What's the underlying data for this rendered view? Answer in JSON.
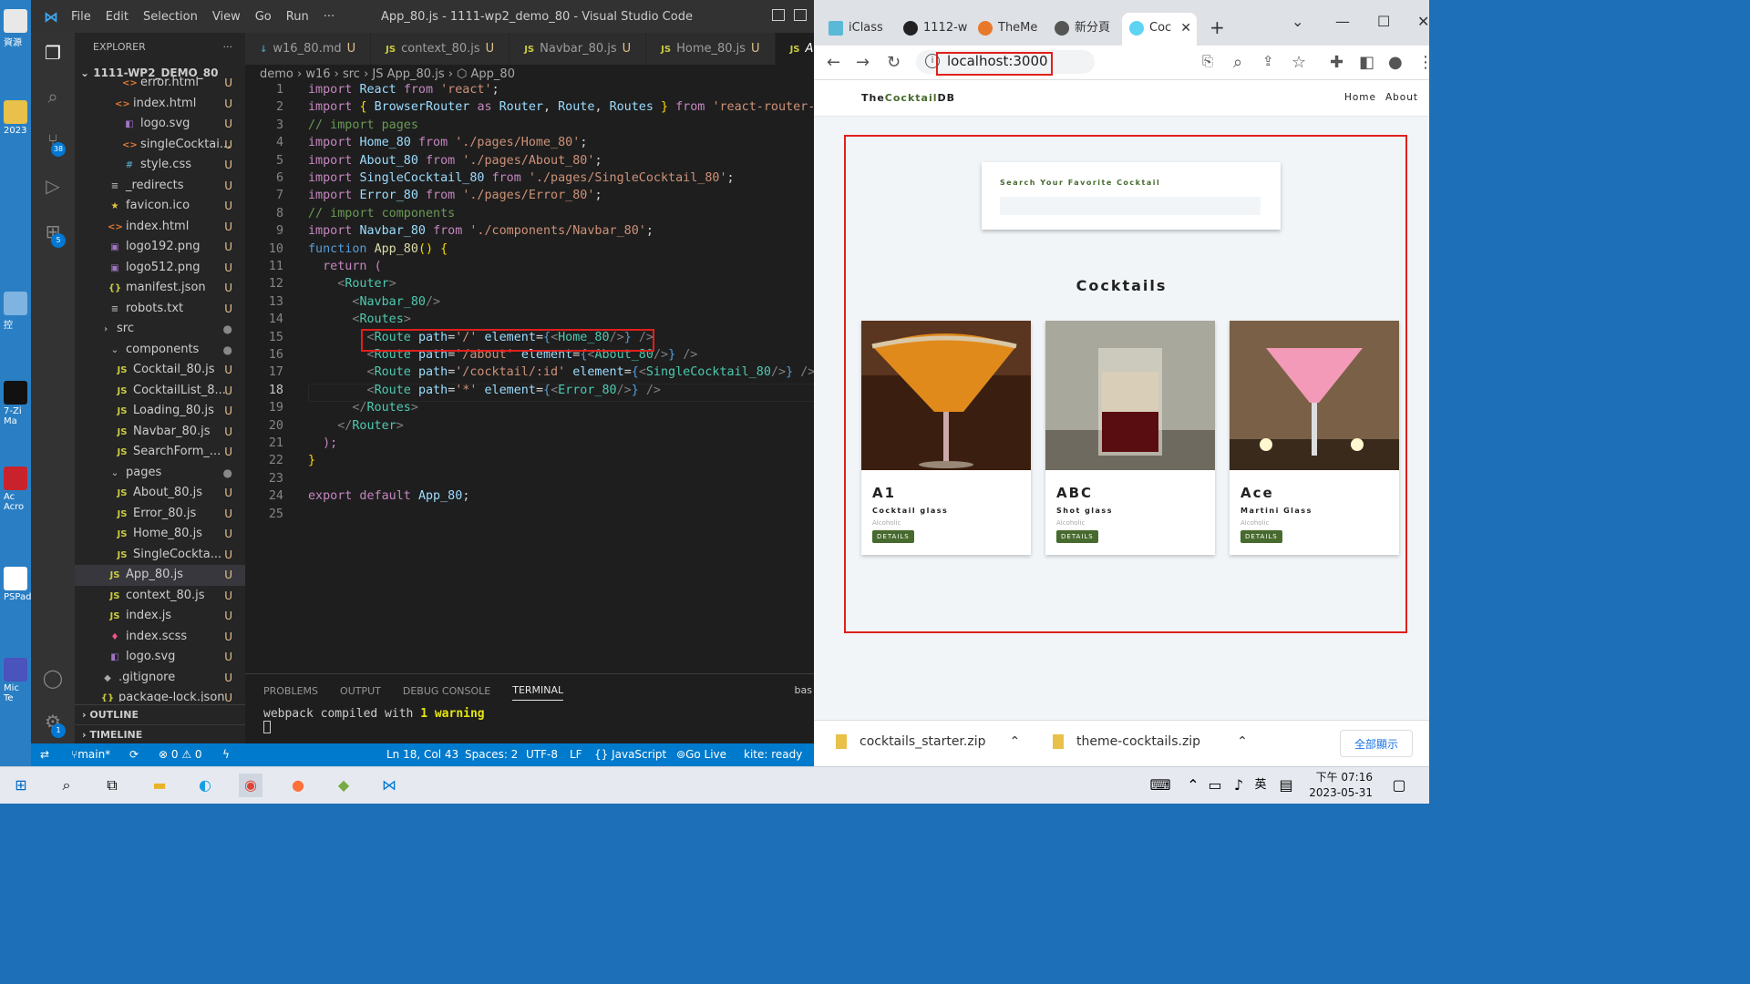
{
  "desktop": {
    "labels": [
      "資源",
      "2023",
      "控",
      "7-Zi Ma",
      "Ac Acro",
      "PSPad",
      "Mic Te"
    ]
  },
  "vscode": {
    "menu": [
      "File",
      "Edit",
      "Selection",
      "View",
      "Go",
      "Run",
      "···"
    ],
    "title": "App_80.js - 1111-wp2_demo_80 - Visual Studio Code",
    "explorer_label": "EXPLORER",
    "project": "1111-WP2_DEMO_80",
    "badges": {
      "scm": "38",
      "extensions": "5",
      "settings": "1"
    },
    "tree": [
      {
        "name": "error.html",
        "status": "U",
        "icon": "<>"
      },
      {
        "name": "index.html",
        "status": "U",
        "icon": "<>"
      },
      {
        "name": "logo.svg",
        "status": "U",
        "icon": "◧"
      },
      {
        "name": "singleCocktai...",
        "status": "U",
        "icon": "<>"
      },
      {
        "name": "style.css",
        "status": "U",
        "icon": "#"
      },
      {
        "name": "_redirects",
        "status": "U",
        "icon": "≡"
      },
      {
        "name": "favicon.ico",
        "status": "U",
        "icon": "★"
      },
      {
        "name": "index.html",
        "status": "U",
        "icon": "<>"
      },
      {
        "name": "logo192.png",
        "status": "U",
        "icon": "▣"
      },
      {
        "name": "logo512.png",
        "status": "U",
        "icon": "▣"
      },
      {
        "name": "manifest.json",
        "status": "U",
        "icon": "{}"
      },
      {
        "name": "robots.txt",
        "status": "U",
        "icon": "≡"
      },
      {
        "name": "src",
        "status": "●",
        "icon": "›"
      },
      {
        "name": "components",
        "status": "●",
        "icon": "⌄"
      },
      {
        "name": "Cocktail_80.js",
        "status": "U",
        "icon": "JS"
      },
      {
        "name": "CocktailList_8...",
        "status": "U",
        "icon": "JS"
      },
      {
        "name": "Loading_80.js",
        "status": "U",
        "icon": "JS"
      },
      {
        "name": "Navbar_80.js",
        "status": "U",
        "icon": "JS"
      },
      {
        "name": "SearchForm_...",
        "status": "U",
        "icon": "JS"
      },
      {
        "name": "pages",
        "status": "●",
        "icon": "⌄"
      },
      {
        "name": "About_80.js",
        "status": "U",
        "icon": "JS"
      },
      {
        "name": "Error_80.js",
        "status": "U",
        "icon": "JS"
      },
      {
        "name": "Home_80.js",
        "status": "U",
        "icon": "JS"
      },
      {
        "name": "SingleCockta...",
        "status": "U",
        "icon": "JS"
      },
      {
        "name": "App_80.js",
        "status": "U",
        "icon": "JS"
      },
      {
        "name": "context_80.js",
        "status": "U",
        "icon": "JS"
      },
      {
        "name": "index.js",
        "status": "U",
        "icon": "JS"
      },
      {
        "name": "index.scss",
        "status": "U",
        "icon": "♦"
      },
      {
        "name": "logo.svg",
        "status": "U",
        "icon": "◧"
      },
      {
        "name": ".gitignore",
        "status": "U",
        "icon": "◆"
      },
      {
        "name": "package-lock.json",
        "status": "U",
        "icon": "{}"
      }
    ],
    "outline": "OUTLINE",
    "timeline": "TIMELINE",
    "tabs": [
      {
        "name": "w16_80.md",
        "status": "U",
        "icon": "↓"
      },
      {
        "name": "context_80.js",
        "status": "U",
        "icon": "JS"
      },
      {
        "name": "Navbar_80.js",
        "status": "U",
        "icon": "JS"
      },
      {
        "name": "Home_80.js",
        "status": "U",
        "icon": "JS"
      },
      {
        "name": "A",
        "status": "",
        "icon": "JS"
      }
    ],
    "breadcrumb": "demo › w16 › src › JS App_80.js › ⬡ App_80",
    "cursor_line": 18,
    "panel_tabs": [
      "PROBLEMS",
      "OUTPUT",
      "DEBUG CONSOLE",
      "TERMINAL"
    ],
    "panel_right": "bas",
    "terminal": {
      "text": "webpack compiled with ",
      "num": "1",
      "warn": "warning"
    },
    "status": {
      "branch": "main*",
      "errors": "⊗ 0 ⚠ 0",
      "position": "Ln 18, Col 43",
      "spaces": "Spaces: 2",
      "encoding": "UTF-8",
      "eol": "LF",
      "lang": "{} JavaScript",
      "golive": "Go Live",
      "kite": "kite: ready"
    }
  },
  "code_lines": [
    [
      [
        "k",
        "import "
      ],
      [
        "v",
        "React "
      ],
      [
        "k",
        "from "
      ],
      [
        "s",
        "'react'"
      ],
      [
        "",
        "; "
      ]
    ],
    [
      [
        "k",
        "import "
      ],
      [
        "b",
        "{ "
      ],
      [
        "v",
        "BrowserRouter "
      ],
      [
        "k",
        "as "
      ],
      [
        "v",
        "Router"
      ],
      [
        "",
        ", "
      ],
      [
        "v",
        "Route"
      ],
      [
        "",
        ", "
      ],
      [
        "v",
        "Routes "
      ],
      [
        "b",
        "} "
      ],
      [
        "k",
        "from "
      ],
      [
        "s",
        "'react-router-do"
      ]
    ],
    [
      [
        "c",
        "// import pages"
      ]
    ],
    [
      [
        "k",
        "import "
      ],
      [
        "v",
        "Home_80 "
      ],
      [
        "k",
        "from "
      ],
      [
        "s",
        "'./pages/Home_80'"
      ],
      [
        "",
        ";"
      ]
    ],
    [
      [
        "k",
        "import "
      ],
      [
        "v",
        "About_80 "
      ],
      [
        "k",
        "from "
      ],
      [
        "s",
        "'./pages/About_80'"
      ],
      [
        "",
        ";"
      ]
    ],
    [
      [
        "k",
        "import "
      ],
      [
        "v",
        "SingleCocktail_80 "
      ],
      [
        "k",
        "from "
      ],
      [
        "s",
        "'./pages/SingleCocktail_80'"
      ],
      [
        "",
        ";"
      ]
    ],
    [
      [
        "k",
        "import "
      ],
      [
        "v",
        "Error_80 "
      ],
      [
        "k",
        "from "
      ],
      [
        "s",
        "'./pages/Error_80'"
      ],
      [
        "",
        ";"
      ]
    ],
    [
      [
        "c",
        "// import components"
      ]
    ],
    [
      [
        "k",
        "import "
      ],
      [
        "v",
        "Navbar_80 "
      ],
      [
        "k",
        "from "
      ],
      [
        "s",
        "'./components/Navbar_80'"
      ],
      [
        "",
        ";"
      ]
    ],
    [
      [
        "t",
        "function "
      ],
      [
        "f",
        "App_80"
      ],
      [
        "b",
        "() {"
      ]
    ],
    [
      [
        "",
        "  "
      ],
      [
        "k",
        "return "
      ],
      [
        "k",
        "("
      ]
    ],
    [
      [
        "",
        "    "
      ],
      [
        "p",
        "<"
      ],
      [
        "n",
        "Router"
      ],
      [
        "p",
        ">"
      ]
    ],
    [
      [
        "",
        "      "
      ],
      [
        "p",
        "<"
      ],
      [
        "n",
        "Navbar_80"
      ],
      [
        "p",
        "/>"
      ]
    ],
    [
      [
        "",
        "      "
      ],
      [
        "p",
        "<"
      ],
      [
        "n",
        "Routes"
      ],
      [
        "p",
        ">"
      ]
    ],
    [
      [
        "",
        "        "
      ],
      [
        "p",
        "<"
      ],
      [
        "n",
        "Route "
      ],
      [
        "v",
        "path"
      ],
      [
        "",
        "="
      ],
      [
        "s",
        "'/' "
      ],
      [
        "v",
        "element"
      ],
      [
        "",
        "="
      ],
      [
        "t",
        "{"
      ],
      [
        "p",
        "<"
      ],
      [
        "n",
        "Home_80"
      ],
      [
        "p",
        "/>"
      ],
      [
        "t",
        "} "
      ],
      [
        "p",
        "/>"
      ]
    ],
    [
      [
        "",
        "        "
      ],
      [
        "p",
        "<"
      ],
      [
        "n",
        "Route "
      ],
      [
        "v",
        "path"
      ],
      [
        "",
        "="
      ],
      [
        "s",
        "'/about' "
      ],
      [
        "v",
        "element"
      ],
      [
        "",
        "="
      ],
      [
        "t",
        "{"
      ],
      [
        "p",
        "<"
      ],
      [
        "n",
        "About_80"
      ],
      [
        "p",
        "/>"
      ],
      [
        "t",
        "} "
      ],
      [
        "p",
        "/>"
      ]
    ],
    [
      [
        "",
        "        "
      ],
      [
        "p",
        "<"
      ],
      [
        "n",
        "Route "
      ],
      [
        "v",
        "path"
      ],
      [
        "",
        "="
      ],
      [
        "s",
        "'/cocktail/:id' "
      ],
      [
        "v",
        "element"
      ],
      [
        "",
        "="
      ],
      [
        "t",
        "{"
      ],
      [
        "p",
        "<"
      ],
      [
        "n",
        "SingleCocktail_80"
      ],
      [
        "p",
        "/>"
      ],
      [
        "t",
        "} "
      ],
      [
        "p",
        "/>"
      ]
    ],
    [
      [
        "",
        "        "
      ],
      [
        "p",
        "<"
      ],
      [
        "n",
        "Route "
      ],
      [
        "v",
        "path"
      ],
      [
        "",
        "="
      ],
      [
        "s",
        "'*' "
      ],
      [
        "v",
        "element"
      ],
      [
        "",
        "="
      ],
      [
        "t",
        "{"
      ],
      [
        "p",
        "<"
      ],
      [
        "n",
        "Error_80"
      ],
      [
        "p",
        "/>"
      ],
      [
        "t",
        "} "
      ],
      [
        "p",
        "/>"
      ]
    ],
    [
      [
        "",
        "      "
      ],
      [
        "p",
        "</"
      ],
      [
        "n",
        "Routes"
      ],
      [
        "p",
        ">"
      ]
    ],
    [
      [
        "",
        "    "
      ],
      [
        "p",
        "</"
      ],
      [
        "n",
        "Router"
      ],
      [
        "p",
        ">"
      ]
    ],
    [
      [
        "",
        "  "
      ],
      [
        "k",
        ");"
      ]
    ],
    [
      [
        "b",
        "}"
      ]
    ],
    [
      [
        "",
        ""
      ]
    ],
    [
      [
        "k",
        "export default "
      ],
      [
        "v",
        "App_80"
      ],
      [
        "",
        ";"
      ]
    ],
    [
      [
        "",
        ""
      ]
    ]
  ],
  "chrome": {
    "tabs": [
      "iClass",
      "1112-w",
      "TheMe",
      "新分頁",
      "Coc"
    ],
    "url": "localhost:3000",
    "site": {
      "brand_a": "The",
      "brand_b": "Cocktail",
      "brand_c": "DB",
      "nav": [
        "Home",
        "About"
      ],
      "search_label": "Search Your Favorite Cocktail",
      "section_title": "Cocktails",
      "cards": [
        {
          "name": "A1",
          "glass": "Cocktail glass",
          "info": "Alcoholic",
          "btn": "DETAILS"
        },
        {
          "name": "ABC",
          "glass": "Shot glass",
          "info": "Alcoholic",
          "btn": "DETAILS"
        },
        {
          "name": "Ace",
          "glass": "Martini Glass",
          "info": "Alcoholic",
          "btn": "DETAILS"
        }
      ]
    },
    "downloads": [
      "cocktails_starter.zip",
      "theme-cocktails.zip"
    ],
    "show_all": "全部顯示"
  },
  "taskbar": {
    "time": "下午 07:16",
    "date": "2023-05-31",
    "ime": "英"
  }
}
